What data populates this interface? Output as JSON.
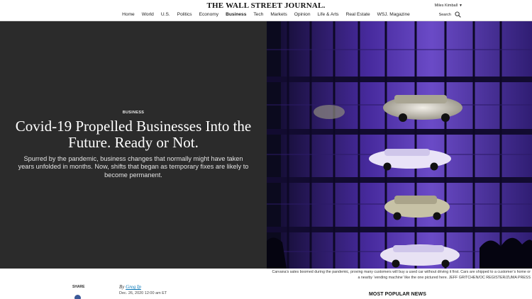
{
  "header": {
    "masthead": "THE WALL STREET JOURNAL.",
    "user_name": "Miles Kimball",
    "search_label": "Search",
    "nav": [
      "Home",
      "World",
      "U.S.",
      "Politics",
      "Economy",
      "Business",
      "Tech",
      "Markets",
      "Opinion",
      "Life & Arts",
      "Real Estate",
      "WSJ. Magazine"
    ],
    "active_nav": "Business"
  },
  "hero": {
    "section": "BUSINESS",
    "headline": "Covid-19 Propelled Businesses Into the Future. Ready or Not.",
    "dek": "Spurred by the pandemic, business changes that normally might have taken years unfolded in months. Now, shifts that began as temporary fixes are likely to become permanent."
  },
  "caption": "Carvana’s sales boomed during the pandemic, proving many customers will buy a used car without driving it first. Cars are shipped to a customer’s home or a nearby ‘vending machine’ like the one pictured here. JEFF GRITCHEN/OC REGISTER/ZUMA PRESS",
  "article": {
    "share_label": "SHARE",
    "by_prefix": "By",
    "author": "Greg Ip",
    "date": "Dec. 26, 2020 12:00 am ET"
  },
  "sidebar": {
    "most_popular": "MOST POPULAR NEWS"
  },
  "colors": {
    "hero_bg": "#2b2b2b",
    "link": "#0274b6",
    "purple_glow": "#8a55ff"
  }
}
